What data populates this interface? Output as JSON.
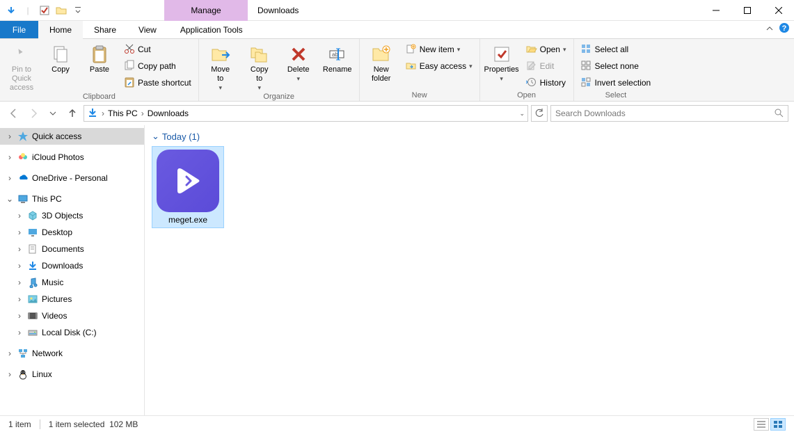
{
  "titlebar": {
    "context_tab": "Manage",
    "window_title": "Downloads"
  },
  "tabs": {
    "file": "File",
    "home": "Home",
    "share": "Share",
    "view": "View",
    "app_tools": "Application Tools"
  },
  "ribbon": {
    "clipboard": {
      "label": "Clipboard",
      "pin": "Pin to Quick\naccess",
      "copy": "Copy",
      "paste": "Paste",
      "cut": "Cut",
      "copy_path": "Copy path",
      "paste_shortcut": "Paste shortcut"
    },
    "organize": {
      "label": "Organize",
      "move_to": "Move\nto",
      "copy_to": "Copy\nto",
      "delete": "Delete",
      "rename": "Rename"
    },
    "new": {
      "label": "New",
      "new_folder": "New\nfolder",
      "new_item": "New item",
      "easy_access": "Easy access"
    },
    "open": {
      "label": "Open",
      "properties": "Properties",
      "open": "Open",
      "edit": "Edit",
      "history": "History"
    },
    "select": {
      "label": "Select",
      "select_all": "Select all",
      "select_none": "Select none",
      "invert": "Invert selection"
    }
  },
  "breadcrumb": {
    "this_pc": "This PC",
    "downloads": "Downloads"
  },
  "search": {
    "placeholder": "Search Downloads"
  },
  "sidebar": {
    "quick_access": "Quick access",
    "icloud": "iCloud Photos",
    "onedrive": "OneDrive - Personal",
    "this_pc": "This PC",
    "children": {
      "objects3d": "3D Objects",
      "desktop": "Desktop",
      "documents": "Documents",
      "downloads": "Downloads",
      "music": "Music",
      "pictures": "Pictures",
      "videos": "Videos",
      "local_disk": "Local Disk (C:)"
    },
    "network": "Network",
    "linux": "Linux"
  },
  "content": {
    "group_label": "Today (1)",
    "file_name": "meget.exe"
  },
  "statusbar": {
    "item_count": "1 item",
    "selection": "1 item selected",
    "size": "102 MB"
  }
}
